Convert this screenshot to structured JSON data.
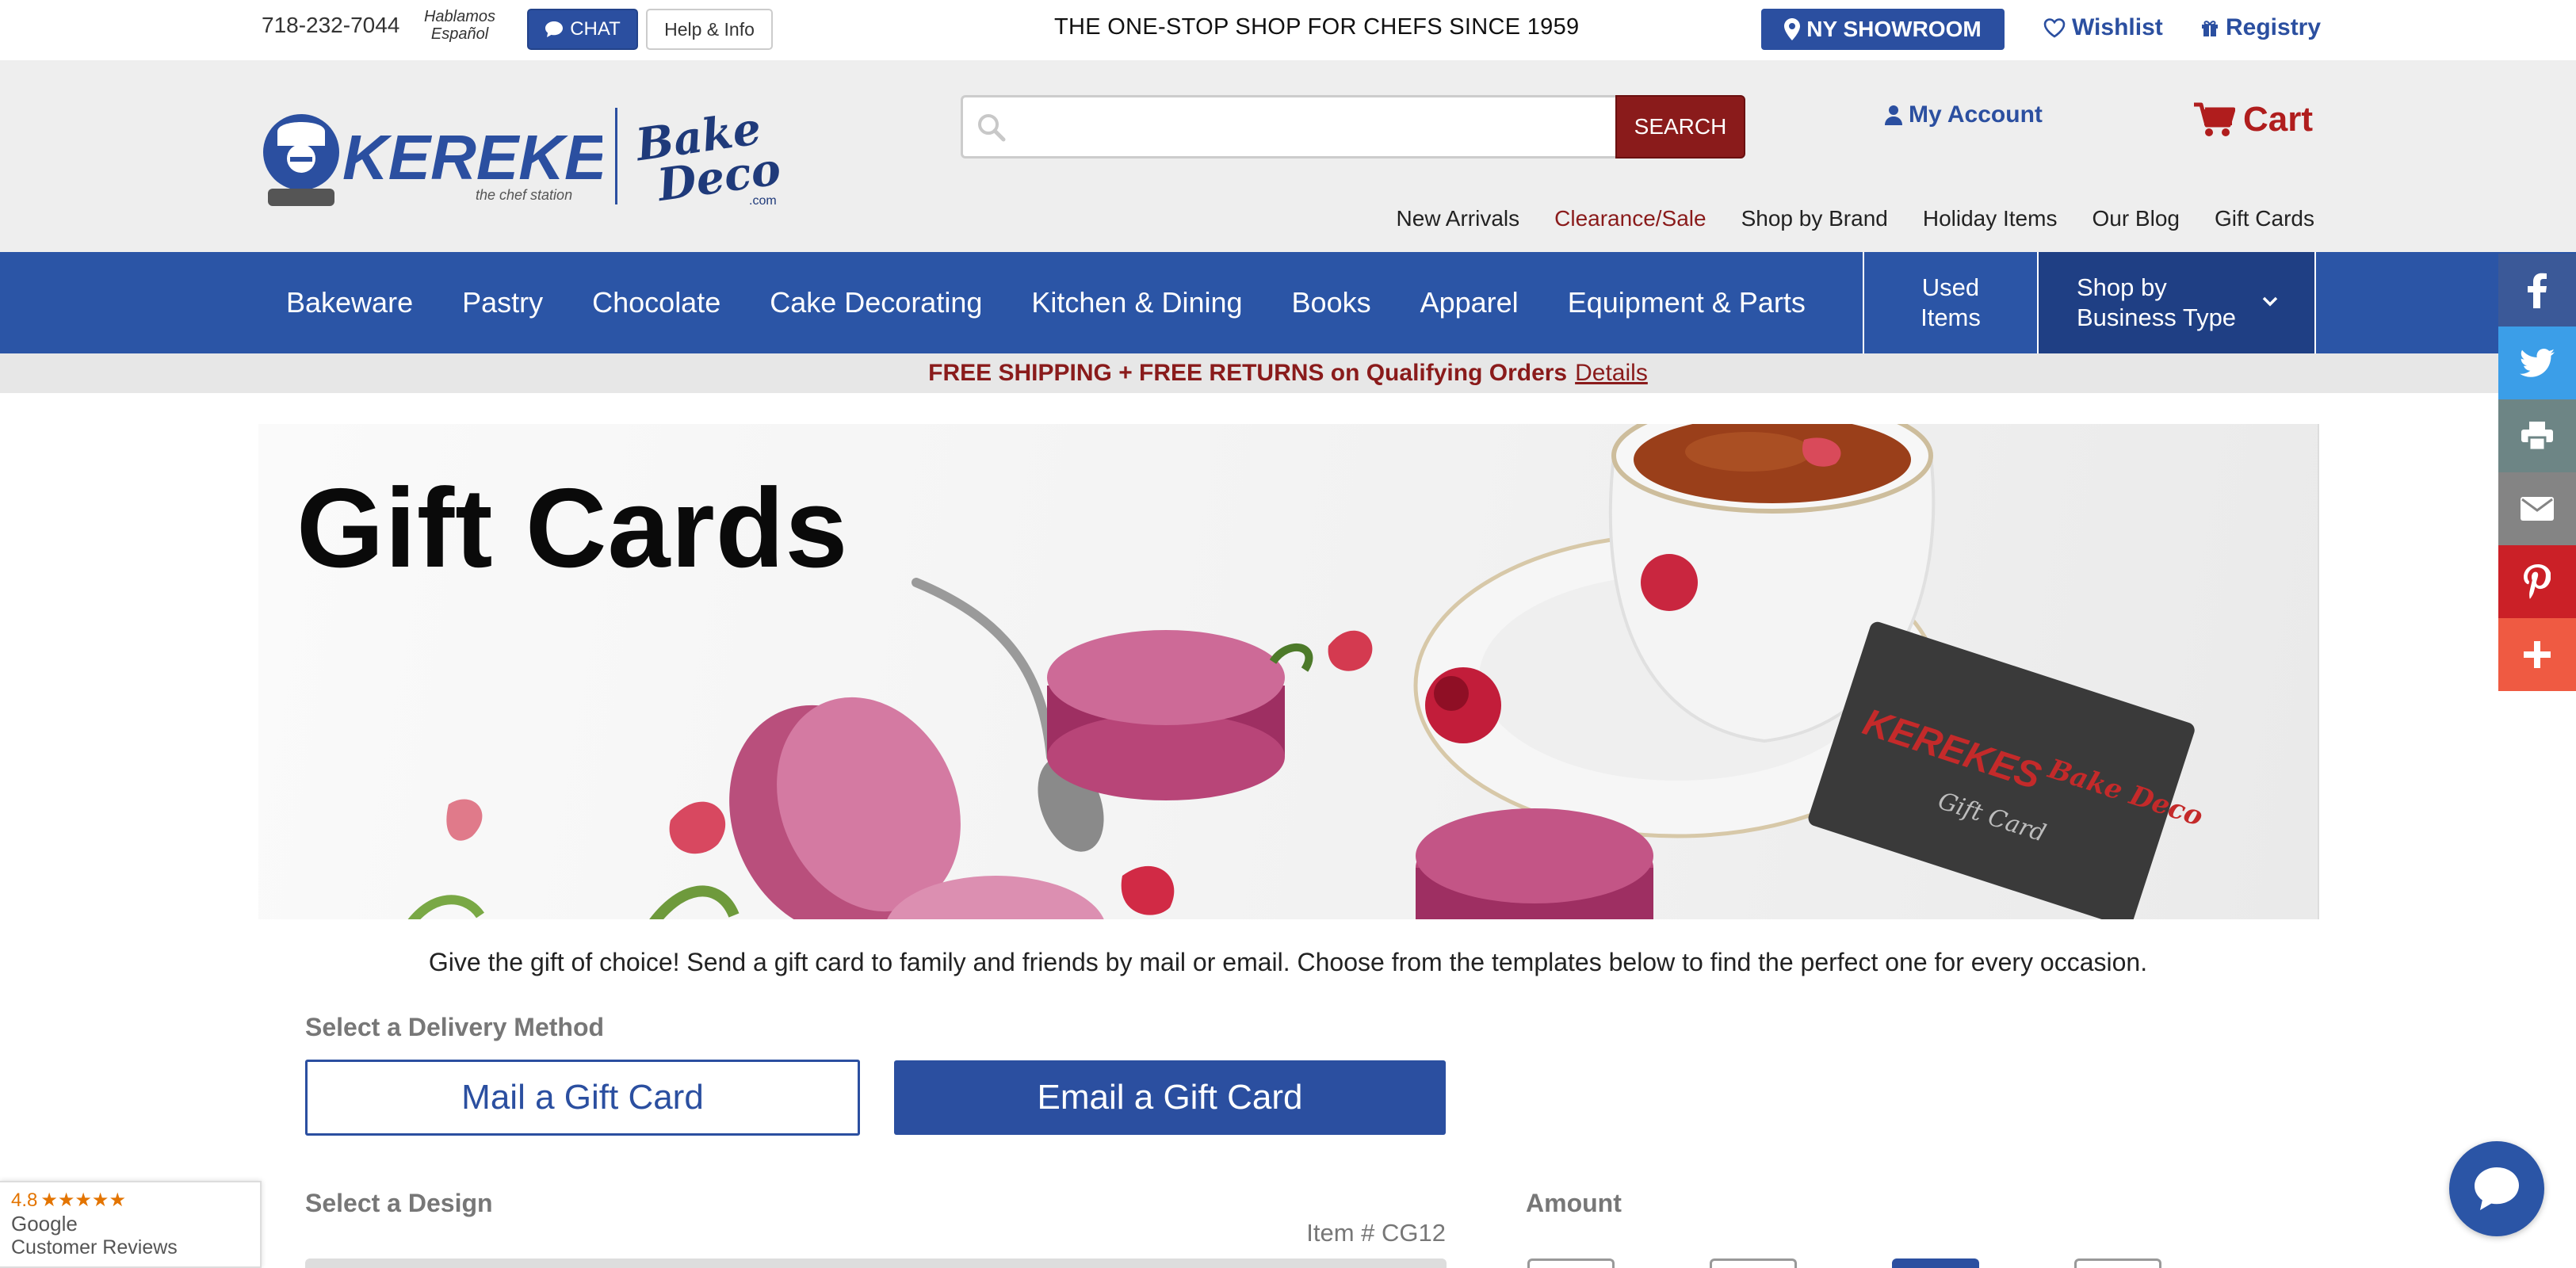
{
  "topbar": {
    "phone": "718-232-7044",
    "hablamos_line1": "Hablamos",
    "hablamos_line2": "Español",
    "chat_label": "CHAT",
    "help_label": "Help & Info",
    "tagline": "THE ONE-STOP SHOP FOR CHEFS SINCE 1959",
    "showroom_label": "NY SHOWROOM",
    "wishlist_label": "Wishlist",
    "registry_label": "Registry"
  },
  "header": {
    "search": {
      "placeholder": "",
      "value": "",
      "button_label": "SEARCH"
    },
    "account_label": "My Account",
    "cart_label": "Cart",
    "logo_kerekes": "KEREKES",
    "logo_kerekes_sub": "the chef station",
    "logo_bakedeco": "Bake Deco",
    "logo_bakedeco_sub": ".com",
    "subnav": [
      "New Arrivals",
      "Clearance/Sale",
      "Shop by Brand",
      "Holiday Items",
      "Our Blog",
      "Gift Cards"
    ]
  },
  "mainnav": {
    "items": [
      "Bakeware",
      "Pastry",
      "Chocolate",
      "Cake Decorating",
      "Kitchen & Dining",
      "Books",
      "Apparel",
      "Equipment & Parts"
    ],
    "used_line1": "Used",
    "used_line2": "Items",
    "bytype_line1": "Shop by",
    "bytype_line2": "Business Type"
  },
  "promo": {
    "text": "FREE SHIPPING + FREE RETURNS on Qualifying Orders",
    "link": "Details"
  },
  "hero": {
    "title": "Gift Cards",
    "card_brand": "KEREKES",
    "card_brand2": "Bake Deco",
    "card_label": "Gift Card"
  },
  "content": {
    "intro": "Give the gift of choice! Send a gift card to family and friends by mail or email. Choose from the templates below to find the perfect one for every occasion.",
    "delivery_label": "Select a Delivery Method",
    "mail_label": "Mail a Gift Card",
    "email_label": "Email a Gift Card",
    "design_label": "Select a Design",
    "item_number": "Item # CG12",
    "amount_label": "Amount",
    "amount_selected_index": 2
  },
  "reviews": {
    "score": "4.8",
    "stars": "★★★★★",
    "provider": "Google",
    "label": "Customer Reviews"
  },
  "social": [
    "facebook-icon",
    "twitter-icon",
    "print-icon",
    "email-icon",
    "pinterest-icon",
    "plus-icon"
  ],
  "colors": {
    "brand_blue": "#2b55a6",
    "brand_red": "#8a1b1b",
    "cart_red": "#b01d1d"
  }
}
